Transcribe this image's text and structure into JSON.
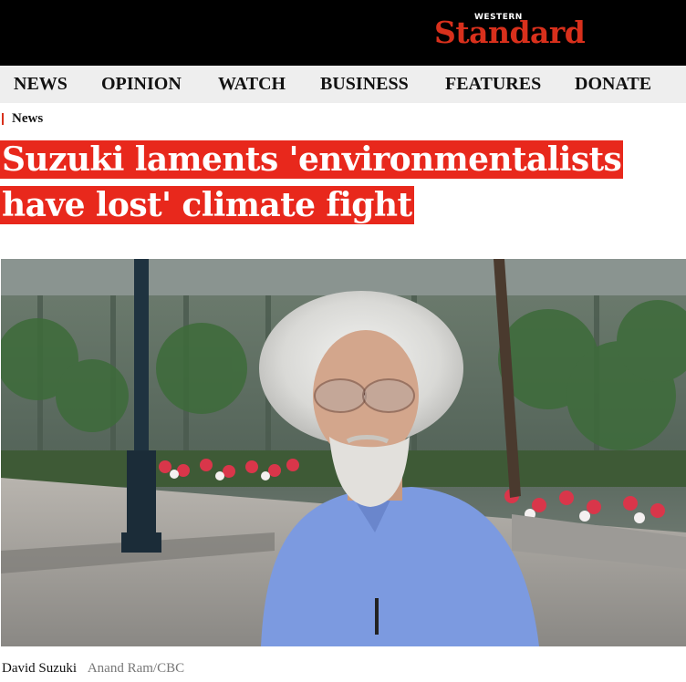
{
  "brand": {
    "small": "WESTERN",
    "name": "Standard",
    "accent": "#d8301c",
    "header_bg": "#000000"
  },
  "nav": {
    "items": [
      {
        "label": "NEWS"
      },
      {
        "label": "OPINION"
      },
      {
        "label": "WATCH"
      },
      {
        "label": "BUSINESS"
      },
      {
        "label": "FEATURES"
      },
      {
        "label": "DONATE"
      }
    ]
  },
  "article": {
    "section": "News",
    "headline_line1": "Suzuki laments 'environmentalists",
    "headline_line2": "have lost' climate fight",
    "headline_bg": "#e8281c",
    "caption": "David Suzuki",
    "credit": "Anand Ram/CBC"
  }
}
